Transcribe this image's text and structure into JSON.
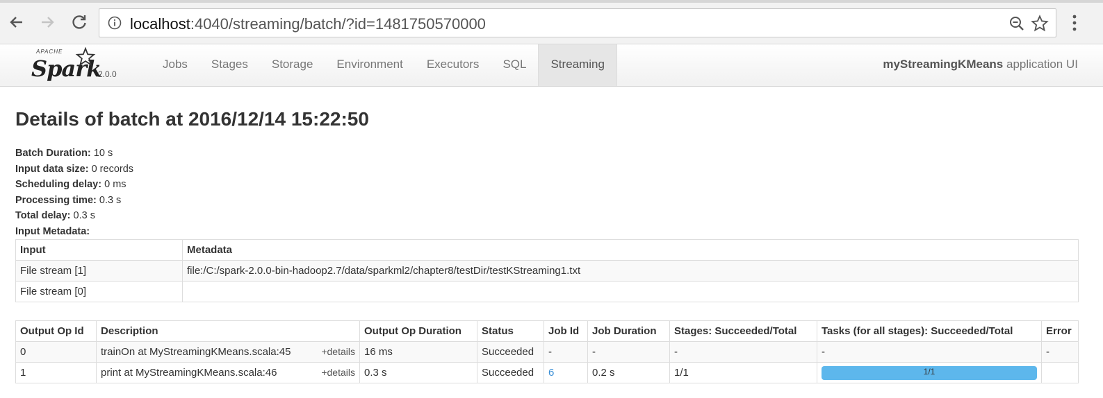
{
  "browser": {
    "url_host": "localhost",
    "url_rest": ":4040/streaming/batch/?id=1481750570000"
  },
  "navbar": {
    "brand_apache": "APACHE",
    "brand_name": "Spark",
    "version": "2.0.0",
    "tabs": [
      {
        "label": "Jobs"
      },
      {
        "label": "Stages"
      },
      {
        "label": "Storage"
      },
      {
        "label": "Environment"
      },
      {
        "label": "Executors"
      },
      {
        "label": "SQL"
      },
      {
        "label": "Streaming",
        "active": true
      }
    ],
    "app_name": "myStreamingKMeans",
    "app_suffix": "application UI"
  },
  "page": {
    "title": "Details of batch at 2016/12/14 15:22:50",
    "summary": [
      {
        "label": "Batch Duration:",
        "value": "10 s"
      },
      {
        "label": "Input data size:",
        "value": "0 records"
      },
      {
        "label": "Scheduling delay:",
        "value": "0 ms"
      },
      {
        "label": "Processing time:",
        "value": "0.3 s"
      },
      {
        "label": "Total delay:",
        "value": "0.3 s"
      },
      {
        "label": "Input Metadata:",
        "value": ""
      }
    ]
  },
  "input_table": {
    "headers": [
      "Input",
      "Metadata"
    ],
    "rows": [
      [
        "File stream [1]",
        "file:/C:/spark-2.0.0-bin-hadoop2.7/data/sparkml2/chapter8/testDir/testKStreaming1.txt"
      ],
      [
        "File stream [0]",
        ""
      ]
    ]
  },
  "ops_table": {
    "headers": [
      "Output Op Id",
      "Description",
      "Output Op Duration",
      "Status",
      "Job Id",
      "Job Duration",
      "Stages: Succeeded/Total",
      "Tasks (for all stages): Succeeded/Total",
      "Error"
    ],
    "details_label": "+details",
    "rows": [
      {
        "id": "0",
        "description": "trainOn at MyStreamingKMeans.scala:45",
        "duration": "16 ms",
        "status": "Succeeded",
        "job_id": "-",
        "job_duration": "-",
        "stages": "-",
        "tasks": "-",
        "error": "-"
      },
      {
        "id": "1",
        "description": "print at MyStreamingKMeans.scala:46",
        "duration": "0.3 s",
        "status": "Succeeded",
        "job_id": "6",
        "job_duration": "0.2 s",
        "stages": "1/1",
        "tasks_progress": "1/1",
        "tasks_fraction": 1.0,
        "error": ""
      }
    ]
  },
  "colors": {
    "link": "#3a8fd6",
    "progress": "#5db7ec"
  }
}
